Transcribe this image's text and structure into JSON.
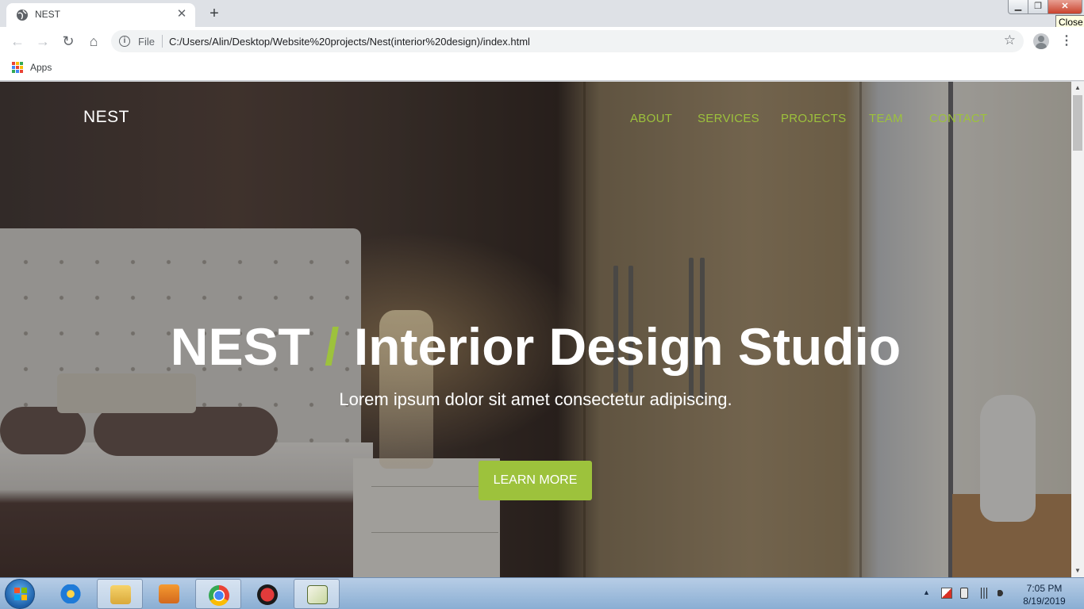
{
  "browser": {
    "tab": {
      "title": "NEST",
      "close_glyph": "✕",
      "favicon": "globe-icon"
    },
    "new_tab_glyph": "+",
    "window_controls": {
      "minimize": "▁",
      "maximize": "❐",
      "close": "✕",
      "close_tooltip": "Close"
    },
    "toolbar": {
      "back": "←",
      "forward": "→",
      "reload": "↻",
      "home": "⌂",
      "scheme_label": "File",
      "url": "C:/Users/Alin/Desktop/Website%20projects/Nest(interior%20design)/index.html",
      "star": "☆",
      "menu": "⋮"
    },
    "bookmarks": {
      "apps_label": "Apps"
    }
  },
  "page": {
    "brand": "NEST",
    "nav": [
      "ABOUT",
      "SERVICES",
      "PROJECTS",
      "TEAM",
      "CONTACT"
    ],
    "hero": {
      "title_strong": "NEST",
      "title_slash": "/",
      "title_rest": "Interior Design Studio",
      "subtitle": "Lorem ipsum dolor sit amet consectetur adipiscing.",
      "cta": "LEARN MORE"
    },
    "colors": {
      "accent": "#9dc23c",
      "text": "#ffffff"
    }
  },
  "scrollbar": {
    "up": "▲",
    "down": "▼"
  },
  "taskbar": {
    "apps": [
      "internet-explorer-icon",
      "file-explorer-icon",
      "media-player-icon",
      "chrome-icon",
      "app-red-icon",
      "notepad-chart-icon"
    ],
    "tray_arrow": "▲",
    "time": "7:05 PM",
    "date": "8/19/2019"
  }
}
